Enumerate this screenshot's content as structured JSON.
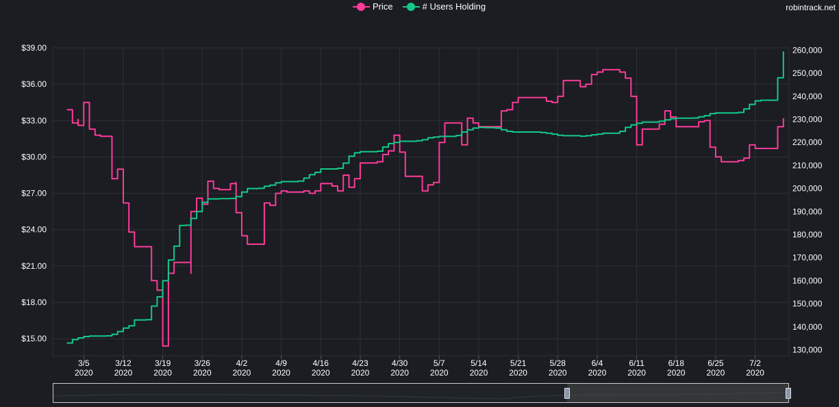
{
  "brand": "robintrack.net",
  "legend": [
    {
      "label": "Price",
      "color": "#ff3b9a"
    },
    {
      "label": "# Users Holding",
      "color": "#14c98a"
    }
  ],
  "chart_data": {
    "type": "line",
    "x_ticks": [
      {
        "day": "3/5",
        "year": "2020"
      },
      {
        "day": "3/12",
        "year": "2020"
      },
      {
        "day": "3/19",
        "year": "2020"
      },
      {
        "day": "3/26",
        "year": "2020"
      },
      {
        "day": "4/2",
        "year": "2020"
      },
      {
        "day": "4/9",
        "year": "2020"
      },
      {
        "day": "4/16",
        "year": "2020"
      },
      {
        "day": "4/23",
        "year": "2020"
      },
      {
        "day": "4/30",
        "year": "2020"
      },
      {
        "day": "5/7",
        "year": "2020"
      },
      {
        "day": "5/14",
        "year": "2020"
      },
      {
        "day": "5/21",
        "year": "2020"
      },
      {
        "day": "5/28",
        "year": "2020"
      },
      {
        "day": "6/4",
        "year": "2020"
      },
      {
        "day": "6/11",
        "year": "2020"
      },
      {
        "day": "6/18",
        "year": "2020"
      },
      {
        "day": "6/25",
        "year": "2020"
      },
      {
        "day": "7/2",
        "year": "2020"
      }
    ],
    "y_left": {
      "ticks": [
        "$15.00",
        "$18.00",
        "$21.00",
        "$24.00",
        "$27.00",
        "$30.00",
        "$33.00",
        "$36.00",
        "$39.00"
      ],
      "range": [
        13.6,
        39.0
      ]
    },
    "y_right": {
      "ticks": [
        "130,000",
        "140,000",
        "150,000",
        "160,000",
        "170,000",
        "180,000",
        "190,000",
        "200,000",
        "210,000",
        "220,000",
        "230,000",
        "240,000",
        "250,000",
        "260,000"
      ],
      "range": [
        127500,
        261000
      ]
    },
    "grid": true,
    "legend_position": "top-center",
    "series": [
      {
        "name": "Price",
        "axis": "left",
        "points": [
          [
            "3/2/2020",
            33.9
          ],
          [
            "3/3/2020",
            33.8
          ],
          [
            "3/3/2020",
            32.8
          ],
          [
            "3/4/2020",
            33.1
          ],
          [
            "3/4/2020",
            32.6
          ],
          [
            "3/5/2020",
            34.5
          ],
          [
            "3/6/2020",
            34.4
          ],
          [
            "3/6/2020",
            32.3
          ],
          [
            "3/7/2020",
            31.8
          ],
          [
            "3/8/2020",
            31.7
          ],
          [
            "3/9/2020",
            31.7
          ],
          [
            "3/10/2020",
            30.5
          ],
          [
            "3/10/2020",
            28.2
          ],
          [
            "3/11/2020",
            29.0
          ],
          [
            "3/12/2020",
            28.9
          ],
          [
            "3/12/2020",
            26.2
          ],
          [
            "3/13/2020",
            23.8
          ],
          [
            "3/14/2020",
            22.6
          ],
          [
            "3/15/2020",
            22.6
          ],
          [
            "3/16/2020",
            22.6
          ],
          [
            "3/17/2020",
            20.2
          ],
          [
            "3/17/2020",
            19.8
          ],
          [
            "3/18/2020",
            19.0
          ],
          [
            "3/19/2020",
            18.9
          ],
          [
            "3/19/2020",
            14.4
          ],
          [
            "3/20/2020",
            16.0
          ],
          [
            "3/20/2020",
            20.4
          ],
          [
            "3/21/2020",
            21.3
          ],
          [
            "3/22/2020",
            21.3
          ],
          [
            "3/23/2020",
            21.3
          ],
          [
            "3/24/2020",
            20.4
          ],
          [
            "3/24/2020",
            25.5
          ],
          [
            "3/25/2020",
            26.6
          ],
          [
            "3/26/2020",
            26.1
          ],
          [
            "3/27/2020",
            28.0
          ],
          [
            "3/28/2020",
            27.4
          ],
          [
            "3/29/2020",
            27.3
          ],
          [
            "3/30/2020",
            27.3
          ],
          [
            "3/31/2020",
            27.8
          ],
          [
            "4/1/2020",
            27.9
          ],
          [
            "4/1/2020",
            25.4
          ],
          [
            "4/2/2020",
            25.2
          ],
          [
            "4/2/2020",
            23.5
          ],
          [
            "4/3/2020",
            22.8
          ],
          [
            "4/4/2020",
            22.8
          ],
          [
            "4/5/2020",
            22.8
          ],
          [
            "4/6/2020",
            22.8
          ],
          [
            "4/6/2020",
            26.2
          ],
          [
            "4/7/2020",
            26.0
          ],
          [
            "4/8/2020",
            27.0
          ],
          [
            "4/9/2020",
            27.2
          ],
          [
            "4/10/2020",
            27.1
          ],
          [
            "4/11/2020",
            27.1
          ],
          [
            "4/12/2020",
            27.1
          ],
          [
            "4/13/2020",
            27.2
          ],
          [
            "4/14/2020",
            27.0
          ],
          [
            "4/15/2020",
            27.2
          ],
          [
            "4/16/2020",
            27.8
          ],
          [
            "4/17/2020",
            27.8
          ],
          [
            "4/18/2020",
            27.6
          ],
          [
            "4/19/2020",
            27.2
          ],
          [
            "4/20/2020",
            28.5
          ],
          [
            "4/21/2020",
            27.5
          ],
          [
            "4/22/2020",
            28.2
          ],
          [
            "4/23/2020",
            29.5
          ],
          [
            "4/24/2020",
            29.5
          ],
          [
            "4/25/2020",
            29.5
          ],
          [
            "4/26/2020",
            29.6
          ],
          [
            "4/27/2020",
            30.2
          ],
          [
            "4/28/2020",
            30.5
          ],
          [
            "4/29/2020",
            31.8
          ],
          [
            "4/30/2020",
            30.4
          ],
          [
            "5/1/2020",
            28.4
          ],
          [
            "5/2/2020",
            28.4
          ],
          [
            "5/3/2020",
            28.4
          ],
          [
            "5/4/2020",
            27.2
          ],
          [
            "5/5/2020",
            27.7
          ],
          [
            "5/6/2020",
            27.9
          ],
          [
            "5/7/2020",
            31.2
          ],
          [
            "5/8/2020",
            32.8
          ],
          [
            "5/9/2020",
            32.8
          ],
          [
            "5/10/2020",
            32.8
          ],
          [
            "5/11/2020",
            31.0
          ],
          [
            "5/12/2020",
            33.2
          ],
          [
            "5/13/2020",
            32.8
          ],
          [
            "5/14/2020",
            32.5
          ],
          [
            "5/15/2020",
            32.5
          ],
          [
            "5/16/2020",
            32.5
          ],
          [
            "5/17/2020",
            32.5
          ],
          [
            "5/18/2020",
            33.8
          ],
          [
            "5/19/2020",
            33.9
          ],
          [
            "5/20/2020",
            34.5
          ],
          [
            "5/21/2020",
            34.9
          ],
          [
            "5/22/2020",
            34.9
          ],
          [
            "5/23/2020",
            34.9
          ],
          [
            "5/24/2020",
            34.9
          ],
          [
            "5/25/2020",
            34.9
          ],
          [
            "5/26/2020",
            34.6
          ],
          [
            "5/27/2020",
            34.5
          ],
          [
            "5/28/2020",
            35.0
          ],
          [
            "5/29/2020",
            36.3
          ],
          [
            "5/30/2020",
            36.3
          ],
          [
            "5/31/2020",
            36.3
          ],
          [
            "6/1/2020",
            35.8
          ],
          [
            "6/2/2020",
            36.0
          ],
          [
            "6/3/2020",
            36.8
          ],
          [
            "6/4/2020",
            37.0
          ],
          [
            "6/5/2020",
            37.2
          ],
          [
            "6/6/2020",
            37.2
          ],
          [
            "6/7/2020",
            37.2
          ],
          [
            "6/8/2020",
            37.0
          ],
          [
            "6/9/2020",
            36.5
          ],
          [
            "6/10/2020",
            35.0
          ],
          [
            "6/11/2020",
            31.0
          ],
          [
            "6/12/2020",
            32.3
          ],
          [
            "6/13/2020",
            32.3
          ],
          [
            "6/14/2020",
            32.3
          ],
          [
            "6/15/2020",
            32.7
          ],
          [
            "6/16/2020",
            33.8
          ],
          [
            "6/17/2020",
            33.3
          ],
          [
            "6/18/2020",
            32.5
          ],
          [
            "6/19/2020",
            32.5
          ],
          [
            "6/20/2020",
            32.5
          ],
          [
            "6/21/2020",
            32.5
          ],
          [
            "6/22/2020",
            32.9
          ],
          [
            "6/23/2020",
            33.0
          ],
          [
            "6/24/2020",
            30.8
          ],
          [
            "6/25/2020",
            30.0
          ],
          [
            "6/26/2020",
            29.6
          ],
          [
            "6/27/2020",
            29.6
          ],
          [
            "6/28/2020",
            29.6
          ],
          [
            "6/29/2020",
            29.7
          ],
          [
            "6/30/2020",
            29.9
          ],
          [
            "7/1/2020",
            31.0
          ],
          [
            "7/2/2020",
            30.7
          ],
          [
            "7/3/2020",
            30.7
          ],
          [
            "7/4/2020",
            30.7
          ],
          [
            "7/5/2020",
            30.7
          ],
          [
            "7/6/2020",
            32.5
          ],
          [
            "7/7/2020",
            33.2
          ]
        ]
      },
      {
        "name": "# Users Holding",
        "axis": "right",
        "points": [
          [
            "3/2/2020",
            133000
          ],
          [
            "3/3/2020",
            133500
          ],
          [
            "3/3/2020",
            134500
          ],
          [
            "3/4/2020",
            135200
          ],
          [
            "3/5/2020",
            135800
          ],
          [
            "3/6/2020",
            136000
          ],
          [
            "3/7/2020",
            136000
          ],
          [
            "3/9/2020",
            136100
          ],
          [
            "3/10/2020",
            136800
          ],
          [
            "3/11/2020",
            138000
          ],
          [
            "3/12/2020",
            139500
          ],
          [
            "3/13/2020",
            140500
          ],
          [
            "3/14/2020",
            143000
          ],
          [
            "3/16/2020",
            143100
          ],
          [
            "3/17/2020",
            149000
          ],
          [
            "3/18/2020",
            153000
          ],
          [
            "3/19/2020",
            160000
          ],
          [
            "3/20/2020",
            169000
          ],
          [
            "3/21/2020",
            175000
          ],
          [
            "3/22/2020",
            184000
          ],
          [
            "3/23/2020",
            184100
          ],
          [
            "3/24/2020",
            184300
          ],
          [
            "3/24/2020",
            187000
          ],
          [
            "3/25/2020",
            190000
          ],
          [
            "3/26/2020",
            194000
          ],
          [
            "3/27/2020",
            195500
          ],
          [
            "3/29/2020",
            195600
          ],
          [
            "3/31/2020",
            195700
          ],
          [
            "4/1/2020",
            196500
          ],
          [
            "4/2/2020",
            198500
          ],
          [
            "4/3/2020",
            200000
          ],
          [
            "4/5/2020",
            200100
          ],
          [
            "4/6/2020",
            201000
          ],
          [
            "4/7/2020",
            201500
          ],
          [
            "4/8/2020",
            202500
          ],
          [
            "4/9/2020",
            203000
          ],
          [
            "4/12/2020",
            203200
          ],
          [
            "4/13/2020",
            204500
          ],
          [
            "4/14/2020",
            206000
          ],
          [
            "4/15/2020",
            207000
          ],
          [
            "4/16/2020",
            208500
          ],
          [
            "4/19/2020",
            208800
          ],
          [
            "4/20/2020",
            211000
          ],
          [
            "4/21/2020",
            214000
          ],
          [
            "4/22/2020",
            215500
          ],
          [
            "4/23/2020",
            216000
          ],
          [
            "4/26/2020",
            216200
          ],
          [
            "4/27/2020",
            218000
          ],
          [
            "4/28/2020",
            219500
          ],
          [
            "4/29/2020",
            220000
          ],
          [
            "4/30/2020",
            220500
          ],
          [
            "5/3/2020",
            220700
          ],
          [
            "5/4/2020",
            221200
          ],
          [
            "5/5/2020",
            222000
          ],
          [
            "5/6/2020",
            222300
          ],
          [
            "5/7/2020",
            222600
          ],
          [
            "5/10/2020",
            223000
          ],
          [
            "5/11/2020",
            224500
          ],
          [
            "5/12/2020",
            225500
          ],
          [
            "5/13/2020",
            226200
          ],
          [
            "5/14/2020",
            226500
          ],
          [
            "5/15/2020",
            226400
          ],
          [
            "5/17/2020",
            226200
          ],
          [
            "5/18/2020",
            225500
          ],
          [
            "5/19/2020",
            224800
          ],
          [
            "5/20/2020",
            224500
          ],
          [
            "5/25/2020",
            224300
          ],
          [
            "5/26/2020",
            224000
          ],
          [
            "5/27/2020",
            223600
          ],
          [
            "5/28/2020",
            223100
          ],
          [
            "5/29/2020",
            222900
          ],
          [
            "6/1/2020",
            222700
          ],
          [
            "6/2/2020",
            222900
          ],
          [
            "6/3/2020",
            223300
          ],
          [
            "6/4/2020",
            223600
          ],
          [
            "6/5/2020",
            224000
          ],
          [
            "6/8/2020",
            224800
          ],
          [
            "6/9/2020",
            226500
          ],
          [
            "6/10/2020",
            227600
          ],
          [
            "6/11/2020",
            228300
          ],
          [
            "6/12/2020",
            228800
          ],
          [
            "6/15/2020",
            229200
          ],
          [
            "6/16/2020",
            229800
          ],
          [
            "6/17/2020",
            230300
          ],
          [
            "6/18/2020",
            230500
          ],
          [
            "6/21/2020",
            230600
          ],
          [
            "6/22/2020",
            231100
          ],
          [
            "6/23/2020",
            231600
          ],
          [
            "6/24/2020",
            232500
          ],
          [
            "6/25/2020",
            232800
          ],
          [
            "6/29/2020",
            233000
          ],
          [
            "6/30/2020",
            234500
          ],
          [
            "7/1/2020",
            236500
          ],
          [
            "7/2/2020",
            238000
          ],
          [
            "7/3/2020",
            238300
          ],
          [
            "7/6/2020",
            238500
          ],
          [
            "7/6/2020",
            248000
          ],
          [
            "7/7/2020",
            259500
          ]
        ]
      }
    ]
  }
}
